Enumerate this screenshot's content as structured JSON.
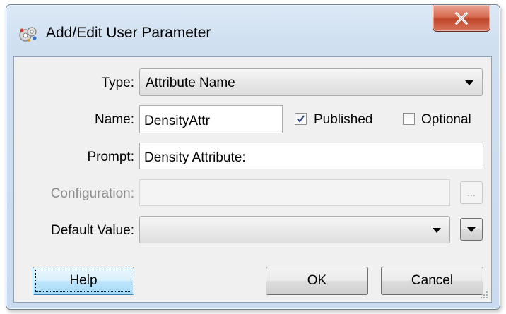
{
  "window": {
    "title": "Add/Edit User Parameter",
    "icon": "parameter-app-icon",
    "close_icon": "close-x-icon"
  },
  "form": {
    "type": {
      "label": "Type:",
      "value": "Attribute Name"
    },
    "name": {
      "label": "Name:",
      "value": "DensityAttr"
    },
    "published": {
      "label": "Published",
      "checked": true
    },
    "optional": {
      "label": "Optional",
      "checked": false
    },
    "prompt": {
      "label": "Prompt:",
      "value": "Density Attribute:"
    },
    "configuration": {
      "label": "Configuration:",
      "value": "",
      "enabled": false,
      "browse_label": "..."
    },
    "default_value": {
      "label": "Default Value:",
      "value": ""
    }
  },
  "buttons": {
    "help": "Help",
    "ok": "OK",
    "cancel": "Cancel"
  },
  "colors": {
    "close_button": "#c9553a",
    "default_button_border": "#3c7fb1",
    "disabled_text": "#8d8d8d"
  }
}
